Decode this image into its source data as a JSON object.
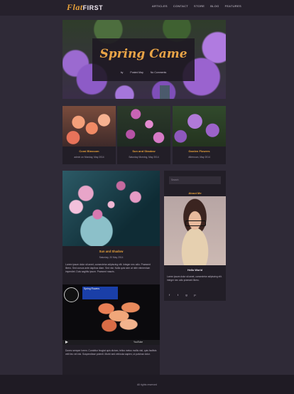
{
  "brand": {
    "logo_word": "Flat",
    "logo_word_2": "FIRST"
  },
  "nav": [
    "ARTICLES",
    "CONTACT",
    "STORE",
    "BLOG",
    "FEATURES"
  ],
  "hero": {
    "title": "Spring Came",
    "meta": [
      "by",
      "Posted May",
      "No Comments"
    ]
  },
  "cards": [
    {
      "title": "Coral Blossom",
      "meta": "admin on Monday, May 2014"
    },
    {
      "title": "Sun and Shadow",
      "meta": "Saturday Morning, May 2014"
    },
    {
      "title": "Garden Flowers",
      "meta": "Afternoon, May 2014"
    }
  ],
  "post": {
    "title": "Sun and Shadow",
    "meta": "Saturday, 20 May 2014",
    "excerpt": "Lorem ipsum dolor sit amet, consectetur adipiscing elit. Integer nec odio. Praesent libero. Sed cursus ante dapibus diam. Sed nisi. Nulla quis sem at nibh elementum imperdiet. Duis sagittis ipsum. Praesent mauris.",
    "video": {
      "title_box": "Spring Flowers",
      "logo": "YouTube"
    },
    "footer_text": "Donec semper lorem. Curabitur feugiat quis dictum, tellus metus mollis nisl, quis facilisis velit leo vel nisi. Suspendisse potenti. Morbi sed vehicula sapien, ut pulvinar dolor."
  },
  "sidebar": {
    "search_placeholder": "Search",
    "about_heading": "About Me",
    "name": "Hello World",
    "bio": "Lorem ipsum dolor sit amet, consectetur adipiscing elit. Integer nec odio praesent libero.",
    "social": [
      "f",
      "t",
      "g",
      "p"
    ]
  },
  "footer": {
    "text": "All rights reserved"
  }
}
